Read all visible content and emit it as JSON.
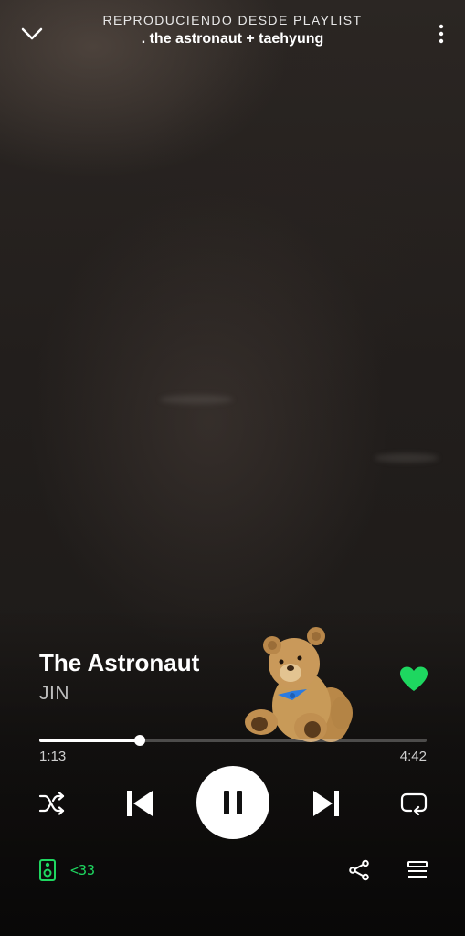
{
  "header": {
    "context_label": "REPRODUCIENDO DESDE PLAYLIST",
    "context_name": ". the astronaut + taehyung",
    "collapse_icon": "chevron-down-icon",
    "more_icon": "more-vertical-icon"
  },
  "track": {
    "title": "The Astronaut",
    "artist": "JIN",
    "liked": true
  },
  "progress": {
    "elapsed": "1:13",
    "total": "4:42",
    "fraction": 0.259
  },
  "controls": {
    "shuffle_icon": "shuffle-icon",
    "previous_icon": "skip-previous-icon",
    "play_state": "playing",
    "next_icon": "skip-next-icon",
    "repeat_icon": "repeat-icon"
  },
  "footer": {
    "device_icon": "speaker-device-icon",
    "device_name": "<33",
    "share_icon": "share-icon",
    "queue_icon": "queue-icon"
  },
  "colors": {
    "accent": "#1ed760",
    "text_primary": "#ffffff",
    "text_secondary": "#bdbdbd"
  }
}
